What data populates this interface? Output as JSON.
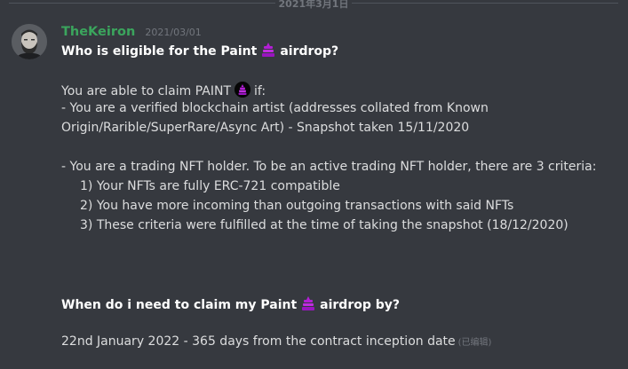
{
  "date_divider": "2021年3月1日",
  "message": {
    "author": "TheKeiron",
    "timestamp": "2021/03/01",
    "title": {
      "before": "Who is eligible for the Paint",
      "after": "airdrop?"
    },
    "claim": {
      "before": "You are able to claim PAINT",
      "after": "if:"
    },
    "artist_line_1": "- You are a verified blockchain artist (addresses collated from Known",
    "artist_line_2": "Origin/Rarible/SuperRare/Async Art) - Snapshot taken 15/11/2020",
    "holder_line": "- You are a trading NFT holder. To be an active trading NFT holder, there are 3 criteria:",
    "criteria": [
      "1) Your NFTs are fully ERC-721 compatible",
      "2) You have more incoming than outgoing transactions with said NFTs",
      "3) These criteria were fulfilled at the time of taking the snapshot (18/12/2020)"
    ],
    "deadline_q": {
      "before": "When do i need to claim my Paint",
      "after": "airdrop by?"
    },
    "deadline_a": "22nd January 2022 - 365 days from the contract inception date",
    "edited_label": "(已编辑)"
  },
  "icons": {
    "avatar": "bearded-man-avatar",
    "paint_emoji": "paint-brush-emoji",
    "paint_token": "paint-token-icon"
  },
  "colors": {
    "background": "#36393f",
    "username": "#3ba55d",
    "text": "#dcddde",
    "muted": "#72767d",
    "emoji_purple": "#b31ed6"
  }
}
